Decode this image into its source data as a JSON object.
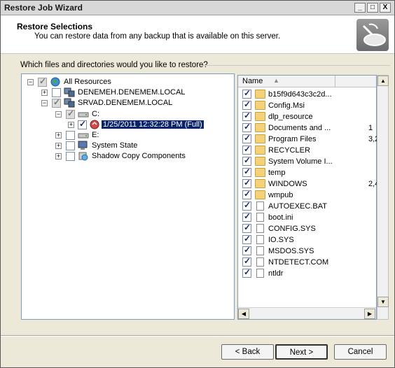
{
  "window": {
    "title": "Restore Job Wizard",
    "minimize": "_",
    "maximize": "□",
    "close": "X"
  },
  "header": {
    "title": "Restore Selections",
    "subtitle": "You can restore data from any backup that is available on this server."
  },
  "question": "Which files and directories would you like to restore?",
  "tree": {
    "root": "All Resources",
    "server1": "DENEMEH.DENEMEM.LOCAL",
    "server2": "SRVAD.DENEMEM.LOCAL",
    "driveC": "C:",
    "backupSet": "1/25/2011 12:32:28 PM (Full)",
    "driveE": "E:",
    "systemState": "System State",
    "shadowCopy": "Shadow Copy Components"
  },
  "list": {
    "column_name": "Name",
    "items": [
      {
        "name": "b15f9d643c3c2d...",
        "type": "folder",
        "size": ""
      },
      {
        "name": "Config.Msi",
        "type": "folder",
        "size": ""
      },
      {
        "name": "dlp_resource",
        "type": "folder",
        "size": ""
      },
      {
        "name": "Documents and ...",
        "type": "folder",
        "size": "1"
      },
      {
        "name": "Program Files",
        "type": "folder",
        "size": "3,2"
      },
      {
        "name": "RECYCLER",
        "type": "folder",
        "size": ""
      },
      {
        "name": "System Volume I...",
        "type": "folder",
        "size": ""
      },
      {
        "name": "temp",
        "type": "folder",
        "size": ""
      },
      {
        "name": "WINDOWS",
        "type": "folder",
        "size": "2,4"
      },
      {
        "name": "wmpub",
        "type": "folder",
        "size": ""
      },
      {
        "name": "AUTOEXEC.BAT",
        "type": "file",
        "size": ""
      },
      {
        "name": "boot.ini",
        "type": "file",
        "size": ""
      },
      {
        "name": "CONFIG.SYS",
        "type": "file",
        "size": ""
      },
      {
        "name": "IO.SYS",
        "type": "file",
        "size": ""
      },
      {
        "name": "MSDOS.SYS",
        "type": "file",
        "size": ""
      },
      {
        "name": "NTDETECT.COM",
        "type": "file",
        "size": ""
      },
      {
        "name": "ntldr",
        "type": "file",
        "size": ""
      }
    ]
  },
  "buttons": {
    "back": "< Back",
    "next": "Next >",
    "cancel": "Cancel"
  }
}
